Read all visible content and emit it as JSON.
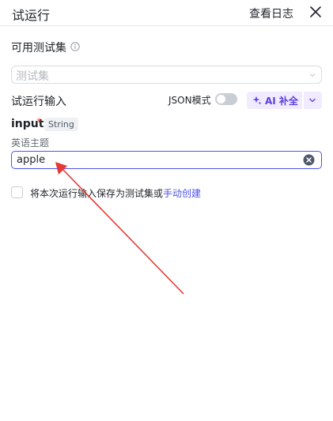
{
  "header": {
    "title": "试运行",
    "view_log": "查看日志",
    "close_icon": "close-icon"
  },
  "testset": {
    "label": "可用测试集",
    "info_icon": "info-icon",
    "placeholder": "测试集",
    "chevron_icon": "chevron-down-icon"
  },
  "run_input": {
    "label": "试运行输入",
    "json_mode_label": "JSON模式",
    "json_mode_enabled": false,
    "ai_button_label": "AI 补全",
    "ai_icon": "sparkle-icon",
    "ai_dropdown_icon": "chevron-down-icon"
  },
  "variable": {
    "name": "input",
    "required_mark": "*",
    "type": "String",
    "description": "英语主题",
    "value": "apple",
    "clear_icon": "clear-icon"
  },
  "save_option": {
    "checked": false,
    "text": "将本次运行输入保存为测试集或",
    "link_text": "手动创建"
  },
  "colors": {
    "accent": "#4d53e8",
    "ai_bg": "#f0ebff",
    "ai_text": "#5a3ee0",
    "required": "#f54a45",
    "annotation_arrow": "#e53935"
  }
}
